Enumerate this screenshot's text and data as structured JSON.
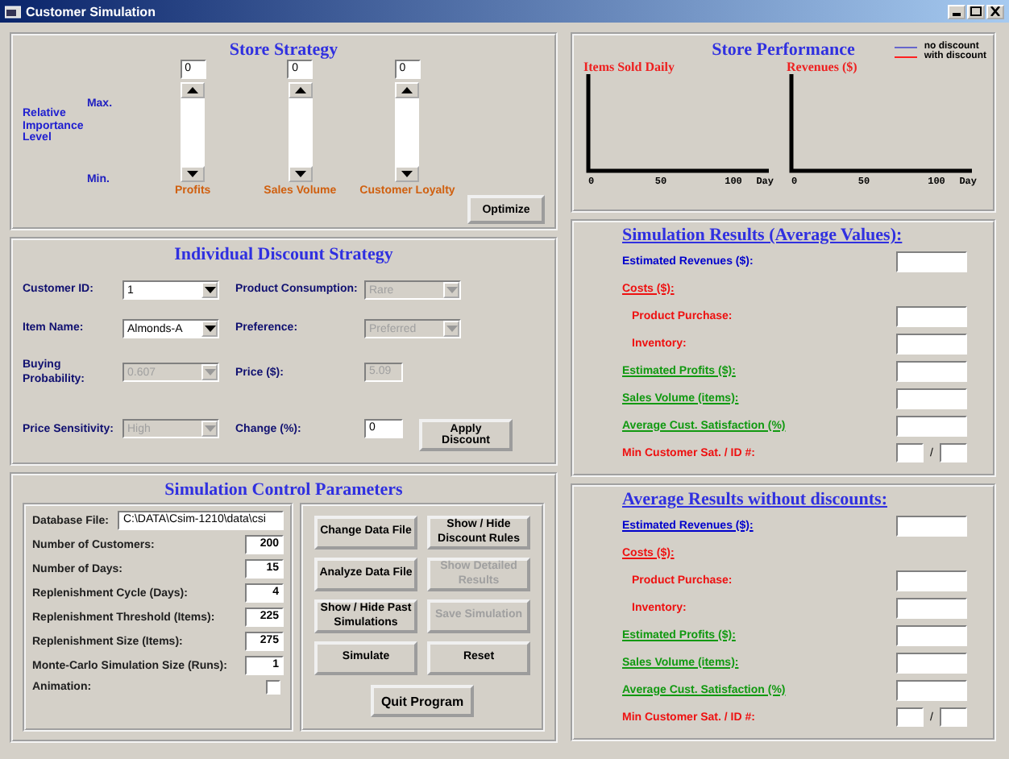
{
  "window": {
    "title": "Customer Simulation"
  },
  "store_strategy": {
    "title": "Store Strategy",
    "axis_label": "Relative Importance Level",
    "max_label": "Max.",
    "min_label": "Min.",
    "sliders": [
      {
        "value": "0",
        "label": "Profits",
        "level": 0
      },
      {
        "value": "0",
        "label": "Sales Volume",
        "level": 0
      },
      {
        "value": "0",
        "label": "Customer Loyalty",
        "level": 0
      }
    ],
    "optimize_button": "Optimize"
  },
  "discount_strategy": {
    "title": "Individual Discount Strategy",
    "fields": [
      {
        "label": "Customer ID:",
        "value": "1",
        "kind": "dropdown",
        "disabled": false
      },
      {
        "label": "Product Consumption:",
        "value": "Rare",
        "kind": "dropdown",
        "disabled": true
      },
      {
        "label": "Item Name:",
        "value": "Almonds-A",
        "kind": "dropdown",
        "disabled": false
      },
      {
        "label": "Preference:",
        "value": "Preferred",
        "kind": "dropdown",
        "disabled": true
      },
      {
        "label": "Buying Probability:",
        "value": "0.607",
        "kind": "dropdown",
        "disabled": true
      },
      {
        "label": "Price ($):",
        "value": "5.09",
        "kind": "text",
        "disabled": true
      },
      {
        "label": "Price Sensitivity:",
        "value": "High",
        "kind": "dropdown",
        "disabled": true
      },
      {
        "label": "Change (%):",
        "value": "0",
        "kind": "text",
        "disabled": false
      }
    ],
    "apply_button": "Apply Discount"
  },
  "simulation_control": {
    "title": "Simulation Control Parameters",
    "params": [
      {
        "label": "Database File:",
        "value": "C:\\DATA\\Csim-1210\\data\\csi",
        "kind": "path"
      },
      {
        "label": "Number of Customers:",
        "value": "200",
        "kind": "number"
      },
      {
        "label": "Number of Days:",
        "value": "15",
        "kind": "number"
      },
      {
        "label": "Replenishment Cycle (Days):",
        "value": "4",
        "kind": "number"
      },
      {
        "label": "Replenishment Threshold (Items):",
        "value": "225",
        "kind": "number"
      },
      {
        "label": "Replenishment Size (Items):",
        "value": "275",
        "kind": "number"
      },
      {
        "label": "Monte-Carlo Simulation Size (Runs):",
        "value": "1",
        "kind": "number"
      },
      {
        "label": "Animation:",
        "kind": "checkbox",
        "checked": false
      }
    ],
    "buttons": [
      {
        "label": "Change Data File",
        "disabled": false
      },
      {
        "label": "Show / Hide Discount Rules",
        "disabled": false
      },
      {
        "label": "Analyze Data File",
        "disabled": false
      },
      {
        "label": "Show Detailed Results",
        "disabled": true
      },
      {
        "label": "Show / Hide Past Simulations",
        "disabled": false
      },
      {
        "label": "Save Simulation",
        "disabled": true
      },
      {
        "label": "Simulate",
        "disabled": false
      },
      {
        "label": "Reset",
        "disabled": false
      }
    ],
    "quit_button": "Quit Program"
  },
  "store_performance": {
    "title": "Store Performance",
    "legend": [
      {
        "label": "no discount",
        "color": "#6666cc"
      },
      {
        "label": "with discount",
        "color": "#ff2020"
      }
    ],
    "charts": [
      {
        "title": "Items Sold Daily",
        "xticks": [
          "0",
          "50",
          "100"
        ],
        "xlabel": "Day"
      },
      {
        "title": "Revenues ($)",
        "xticks": [
          "0",
          "50",
          "100"
        ],
        "xlabel": "Day"
      }
    ]
  },
  "results": [
    {
      "title": "Simulation Results (Average Values):",
      "rows": [
        {
          "label": "Estimated Revenues ($):",
          "kind": "field",
          "color": "#0000cc",
          "underlined": false
        },
        {
          "label": "Costs ($):",
          "kind": "group",
          "color": "#ee1111",
          "underlined": true,
          "children": [
            {
              "label": "Product Purchase:",
              "kind": "field",
              "color": "#ee1111",
              "underlined": false
            },
            {
              "label": "Inventory:",
              "kind": "field",
              "color": "#ee1111",
              "underlined": false
            }
          ]
        },
        {
          "label": "Estimated Profits ($):",
          "kind": "field",
          "color": "#119911",
          "underlined": true
        },
        {
          "label": "Sales Volume (items):",
          "kind": "field",
          "color": "#119911",
          "underlined": true
        },
        {
          "label": "Average Cust. Satisfaction (%)",
          "kind": "field",
          "color": "#119911",
          "underlined": true
        },
        {
          "label": "Min Customer Sat. / ID #:",
          "kind": "pair",
          "color": "#ee1111",
          "underlined": false,
          "separator": "/"
        }
      ]
    },
    {
      "title": "Average Results without discounts:",
      "rows": [
        {
          "label": "Estimated Revenues ($):",
          "kind": "field",
          "color": "#0000cc",
          "underlined": true
        },
        {
          "label": "Costs ($):",
          "kind": "group",
          "color": "#ee1111",
          "underlined": true,
          "children": [
            {
              "label": "Product Purchase:",
              "kind": "field",
              "color": "#ee1111",
              "underlined": false
            },
            {
              "label": "Inventory:",
              "kind": "field",
              "color": "#ee1111",
              "underlined": false
            }
          ]
        },
        {
          "label": "Estimated Profits ($):",
          "kind": "field",
          "color": "#119911",
          "underlined": true
        },
        {
          "label": "Sales Volume (items):",
          "kind": "field",
          "color": "#119911",
          "underlined": true
        },
        {
          "label": "Average Cust. Satisfaction (%)",
          "kind": "field",
          "color": "#119911",
          "underlined": true
        },
        {
          "label": "Min Customer Sat. / ID #:",
          "kind": "pair",
          "color": "#ee1111",
          "underlined": false,
          "separator": "/"
        }
      ]
    }
  ]
}
